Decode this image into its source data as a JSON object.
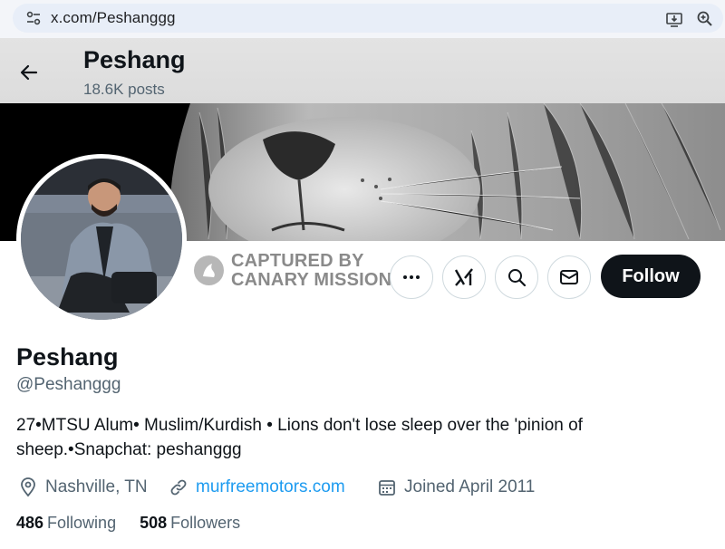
{
  "browser": {
    "url": "x.com/Peshanggg",
    "icons": [
      "site-settings-icon",
      "install-app-icon",
      "zoom-icon"
    ]
  },
  "header": {
    "name": "Peshang",
    "posts": "18.6K posts",
    "icons": [
      "back-arrow-icon"
    ]
  },
  "badge": {
    "line1": "CAPTURED BY",
    "line2": "CANARY MISSION"
  },
  "actions": {
    "icons": [
      "more-icon",
      "grok-icon",
      "search-icon",
      "message-icon"
    ],
    "follow_label": "Follow"
  },
  "profile": {
    "name": "Peshang",
    "handle": "@Peshanggg",
    "bio_line1": "27•MTSU Alum• Muslim/Kurdish • Lions don't lose sleep over the 'pinion of",
    "bio_line2": "sheep.•Snapchat: peshanggg",
    "location": "Nashville, TN",
    "website": "murfreemotors.com",
    "joined": "Joined April 2011",
    "following_count": "486",
    "following_label": "Following",
    "followers_count": "508",
    "followers_label": "Followers"
  },
  "colors": {
    "text": "#0f1419",
    "secondary": "#536471",
    "link": "#1d9bf0",
    "follow_bg": "#0f1419"
  }
}
